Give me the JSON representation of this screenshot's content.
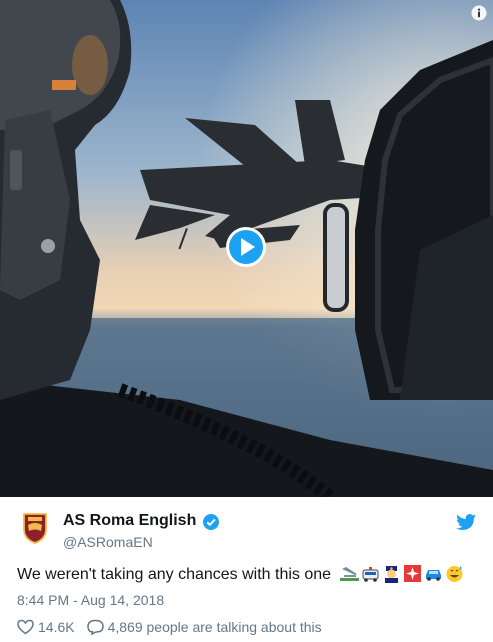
{
  "tweet": {
    "author_name": "AS Roma English",
    "handle": "@ASRomaEN",
    "text": "We weren't taking any chances with this one",
    "emojis": [
      "airplane-arrival-icon",
      "police-car-icon",
      "police-officer-icon",
      "police-light-icon",
      "car-icon",
      "grinning-sweat-icon"
    ],
    "timestamp": "8:44 PM - Aug 14, 2018",
    "likes": "14.6K",
    "talking": "4,869 people are talking about this"
  },
  "media": {
    "type": "video",
    "play_icon": "play-icon",
    "info_icon": "info-icon"
  },
  "colors": {
    "accent": "#1da1f2",
    "text_primary": "#14171a",
    "text_secondary": "#657786",
    "roma_red": "#8e1f2f",
    "roma_gold": "#f0bc42"
  }
}
